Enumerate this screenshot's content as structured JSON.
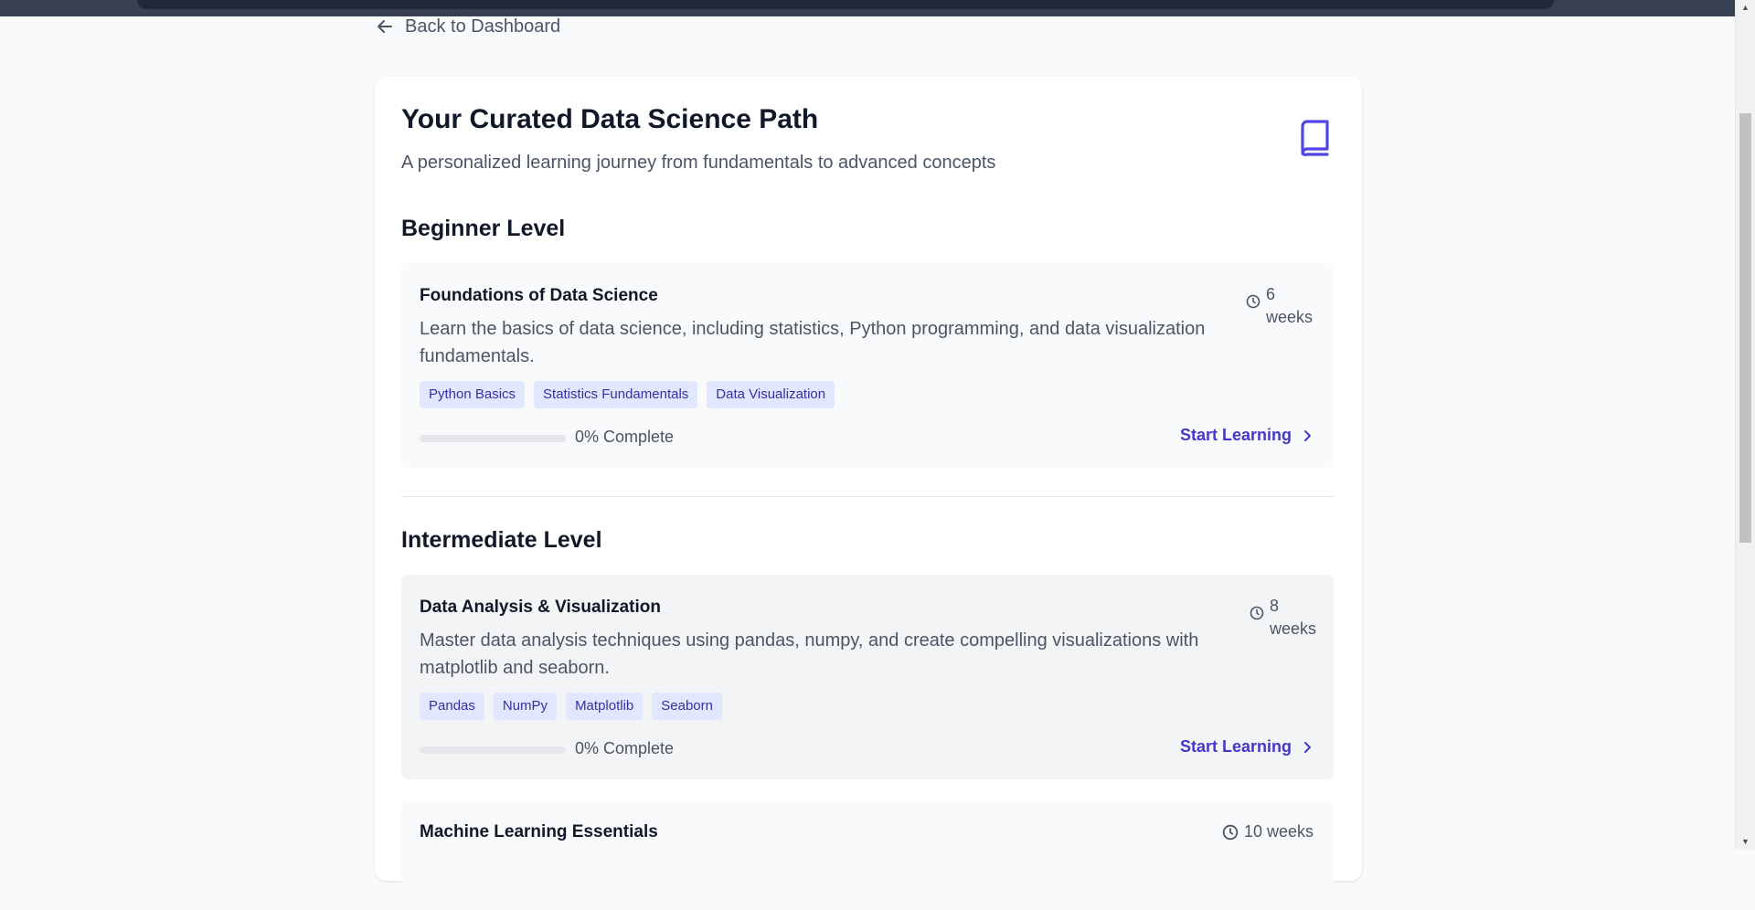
{
  "nav": {
    "back_label": "Back to Dashboard"
  },
  "header": {
    "title": "Your Curated Data Science Path",
    "subtitle": "A personalized learning journey from fundamentals to advanced concepts",
    "icon": "book-icon"
  },
  "levels": [
    {
      "heading": "Beginner Level",
      "courses": [
        {
          "title": "Foundations of Data Science",
          "description": "Learn the basics of data science, including statistics, Python programming, and data visualization fundamentals.",
          "duration_num": "6",
          "duration_unit": "weeks",
          "tags": [
            "Python Basics",
            "Statistics Fundamentals",
            "Data Visualization"
          ],
          "progress": 0,
          "progress_label": "0% Complete",
          "action": "Start Learning"
        }
      ]
    },
    {
      "heading": "Intermediate Level",
      "courses": [
        {
          "title": "Data Analysis & Visualization",
          "description": "Master data analysis techniques using pandas, numpy, and create compelling visualizations with matplotlib and seaborn.",
          "duration_num": "8",
          "duration_unit": "weeks",
          "tags": [
            "Pandas",
            "NumPy",
            "Matplotlib",
            "Seaborn"
          ],
          "progress": 0,
          "progress_label": "0% Complete",
          "action": "Start Learning"
        },
        {
          "title": "Machine Learning Essentials",
          "duration": "10 weeks"
        }
      ]
    }
  ],
  "colors": {
    "accent": "#4f46e5",
    "tag_bg": "#e0e7ff",
    "tag_text": "#3730a3"
  }
}
